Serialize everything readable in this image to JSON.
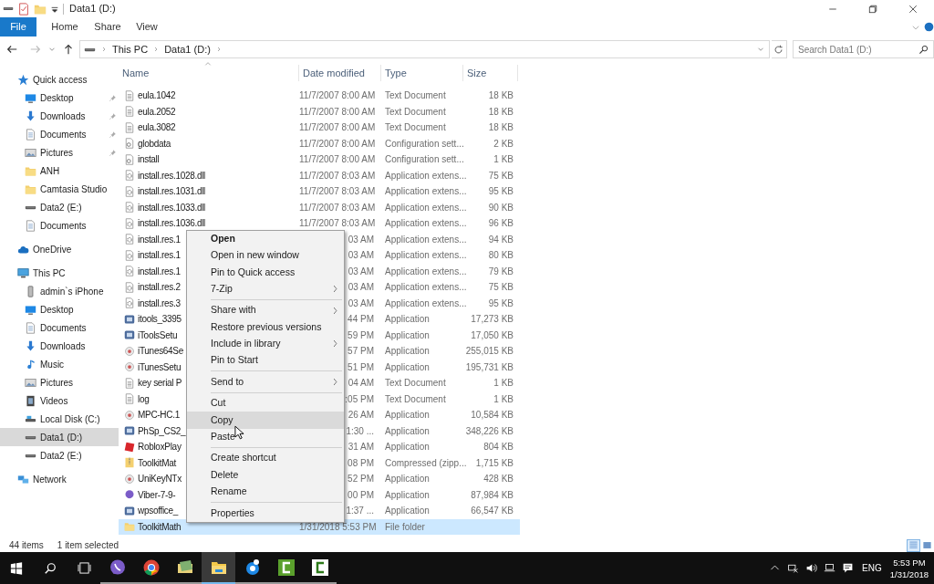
{
  "window": {
    "title": "Data1 (D:)"
  },
  "ribbon_tabs": [
    {
      "label": "File",
      "kind": "file"
    },
    {
      "label": "Home",
      "kind": "tab"
    },
    {
      "label": "Share",
      "kind": "tab"
    },
    {
      "label": "View",
      "kind": "tab"
    }
  ],
  "address": {
    "path": [
      "This PC",
      "Data1 (D:)"
    ],
    "search_placeholder": "Search Data1 (D:)"
  },
  "nav": [
    {
      "label": "Quick access",
      "kind": "star",
      "selected": false,
      "children": [
        {
          "label": "Desktop",
          "kind": "desktop",
          "pinned": true,
          "selected": false
        },
        {
          "label": "Downloads",
          "kind": "download",
          "pinned": true,
          "selected": false
        },
        {
          "label": "Documents",
          "kind": "document",
          "pinned": true,
          "selected": false
        },
        {
          "label": "Pictures",
          "kind": "picture",
          "pinned": true,
          "selected": false
        },
        {
          "label": "ANH",
          "kind": "folder",
          "pinned": false,
          "selected": false
        },
        {
          "label": "Camtasia Studio",
          "kind": "folder",
          "pinned": false,
          "selected": false
        },
        {
          "label": "Data2 (E:)",
          "kind": "drive",
          "pinned": false,
          "selected": false
        },
        {
          "label": "Documents",
          "kind": "document",
          "pinned": false,
          "selected": false
        }
      ]
    },
    {
      "label": "OneDrive",
      "kind": "cloud",
      "selected": false
    },
    {
      "label": "This PC",
      "kind": "pc",
      "selected": false,
      "children": [
        {
          "label": "admin`s iPhone",
          "kind": "phone",
          "selected": false
        },
        {
          "label": "Desktop",
          "kind": "desktop",
          "selected": false
        },
        {
          "label": "Documents",
          "kind": "document",
          "selected": false
        },
        {
          "label": "Downloads",
          "kind": "download",
          "selected": false
        },
        {
          "label": "Music",
          "kind": "music",
          "selected": false
        },
        {
          "label": "Pictures",
          "kind": "picture",
          "selected": false
        },
        {
          "label": "Videos",
          "kind": "video",
          "selected": false
        },
        {
          "label": "Local Disk (C:)",
          "kind": "localdisk",
          "selected": false
        },
        {
          "label": "Data1 (D:)",
          "kind": "drive",
          "selected": true
        },
        {
          "label": "Data2 (E:)",
          "kind": "drive",
          "selected": false
        }
      ]
    },
    {
      "label": "Network",
      "kind": "network",
      "selected": false
    }
  ],
  "file_list": {
    "columns": [
      "Name",
      "Date modified",
      "Type",
      "Size"
    ],
    "rows": [
      {
        "name": "eula.1042",
        "date": "11/7/2007 8:00 AM",
        "type": "Text Document",
        "size": "18 KB",
        "kind": "text",
        "selected": false
      },
      {
        "name": "eula.2052",
        "date": "11/7/2007 8:00 AM",
        "type": "Text Document",
        "size": "18 KB",
        "kind": "text",
        "selected": false
      },
      {
        "name": "eula.3082",
        "date": "11/7/2007 8:00 AM",
        "type": "Text Document",
        "size": "18 KB",
        "kind": "text",
        "selected": false
      },
      {
        "name": "globdata",
        "date": "11/7/2007 8:00 AM",
        "type": "Configuration sett...",
        "size": "2 KB",
        "kind": "config",
        "selected": false
      },
      {
        "name": "install",
        "date": "11/7/2007 8:00 AM",
        "type": "Configuration sett...",
        "size": "1 KB",
        "kind": "config",
        "selected": false
      },
      {
        "name": "install.res.1028.dll",
        "date": "11/7/2007 8:03 AM",
        "type": "Application extens...",
        "size": "75 KB",
        "kind": "dll",
        "selected": false
      },
      {
        "name": "install.res.1031.dll",
        "date": "11/7/2007 8:03 AM",
        "type": "Application extens...",
        "size": "95 KB",
        "kind": "dll",
        "selected": false
      },
      {
        "name": "install.res.1033.dll",
        "date": "11/7/2007 8:03 AM",
        "type": "Application extens...",
        "size": "90 KB",
        "kind": "dll",
        "selected": false
      },
      {
        "name": "install.res.1036.dll",
        "date": "11/7/2007 8:03 AM",
        "type": "Application extens...",
        "size": "96 KB",
        "kind": "dll",
        "selected": false
      },
      {
        "name": "install.res.1",
        "date": "03 AM",
        "type": "Application extens...",
        "size": "94 KB",
        "kind": "dll",
        "selected": false
      },
      {
        "name": "install.res.1",
        "date": "03 AM",
        "type": "Application extens...",
        "size": "80 KB",
        "kind": "dll",
        "selected": false
      },
      {
        "name": "install.res.1",
        "date": "03 AM",
        "type": "Application extens...",
        "size": "79 KB",
        "kind": "dll",
        "selected": false
      },
      {
        "name": "install.res.2",
        "date": "03 AM",
        "type": "Application extens...",
        "size": "75 KB",
        "kind": "dll",
        "selected": false
      },
      {
        "name": "install.res.3",
        "date": "03 AM",
        "type": "Application extens...",
        "size": "95 KB",
        "kind": "dll",
        "selected": false
      },
      {
        "name": "itools_3395",
        "date": "44 PM",
        "type": "Application",
        "size": "17,273 KB",
        "kind": "app",
        "selected": false
      },
      {
        "name": "iToolsSetu",
        "date": "59 PM",
        "type": "Application",
        "size": "17,050 KB",
        "kind": "app",
        "selected": false
      },
      {
        "name": "iTunes64Se",
        "date": "57 PM",
        "type": "Application",
        "size": "255,015 KB",
        "kind": "installer",
        "selected": false
      },
      {
        "name": "iTunesSetu",
        "date": "51 PM",
        "type": "Application",
        "size": "195,731 KB",
        "kind": "installer",
        "selected": false
      },
      {
        "name": "key serial P",
        "date": "04 AM",
        "type": "Text Document",
        "size": "1 KB",
        "kind": "text",
        "selected": false
      },
      {
        "name": "log",
        "date": ":05 PM",
        "type": "Text Document",
        "size": "1 KB",
        "kind": "text",
        "selected": false
      },
      {
        "name": "MPC-HC.1",
        "date": "26 AM",
        "type": "Application",
        "size": "10,584 KB",
        "kind": "installer",
        "selected": false
      },
      {
        "name": "PhSp_CS2_",
        "date": "1:30 ...",
        "type": "Application",
        "size": "348,226 KB",
        "kind": "app",
        "selected": false
      },
      {
        "name": "RobloxPlay",
        "date": "31 AM",
        "type": "Application",
        "size": "804 KB",
        "kind": "roblox",
        "selected": false
      },
      {
        "name": "ToolkitMat",
        "date": "08 PM",
        "type": "Compressed (zipp...",
        "size": "1,715 KB",
        "kind": "zip",
        "selected": false
      },
      {
        "name": "UniKeyNTx",
        "date": "52 PM",
        "type": "Application",
        "size": "428 KB",
        "kind": "installer",
        "selected": false
      },
      {
        "name": "Viber-7-9-",
        "date": "00 PM",
        "type": "Application",
        "size": "87,984 KB",
        "kind": "viber",
        "selected": false
      },
      {
        "name": "wpsoffice_",
        "date": "1:37 ...",
        "type": "Application",
        "size": "66,547 KB",
        "kind": "app",
        "selected": false
      },
      {
        "name": "ToolkitMath",
        "date": "1/31/2018 5:53 PM",
        "type": "File folder",
        "size": "",
        "kind": "folder",
        "selected": true
      }
    ]
  },
  "context_menu": [
    {
      "kind": "item",
      "label": "Open",
      "default": true,
      "submenu": false,
      "highlighted": false
    },
    {
      "kind": "item",
      "label": "Open in new window",
      "default": false,
      "submenu": false,
      "highlighted": false
    },
    {
      "kind": "item",
      "label": "Pin to Quick access",
      "default": false,
      "submenu": false,
      "highlighted": false
    },
    {
      "kind": "item",
      "label": "7-Zip",
      "default": false,
      "submenu": true,
      "highlighted": false
    },
    {
      "kind": "separator"
    },
    {
      "kind": "item",
      "label": "Share with",
      "default": false,
      "submenu": true,
      "highlighted": false
    },
    {
      "kind": "item",
      "label": "Restore previous versions",
      "default": false,
      "submenu": false,
      "highlighted": false
    },
    {
      "kind": "item",
      "label": "Include in library",
      "default": false,
      "submenu": true,
      "highlighted": false
    },
    {
      "kind": "item",
      "label": "Pin to Start",
      "default": false,
      "submenu": false,
      "highlighted": false
    },
    {
      "kind": "separator"
    },
    {
      "kind": "item",
      "label": "Send to",
      "default": false,
      "submenu": true,
      "highlighted": false
    },
    {
      "kind": "separator"
    },
    {
      "kind": "item",
      "label": "Cut",
      "default": false,
      "submenu": false,
      "highlighted": false
    },
    {
      "kind": "item",
      "label": "Copy",
      "default": false,
      "submenu": false,
      "highlighted": true
    },
    {
      "kind": "item",
      "label": "Paste",
      "default": false,
      "submenu": false,
      "highlighted": false
    },
    {
      "kind": "separator"
    },
    {
      "kind": "item",
      "label": "Create shortcut",
      "default": false,
      "submenu": false,
      "highlighted": false
    },
    {
      "kind": "item",
      "label": "Delete",
      "default": false,
      "submenu": false,
      "highlighted": false
    },
    {
      "kind": "item",
      "label": "Rename",
      "default": false,
      "submenu": false,
      "highlighted": false
    },
    {
      "kind": "separator"
    },
    {
      "kind": "item",
      "label": "Properties",
      "default": false,
      "submenu": false,
      "highlighted": false
    }
  ],
  "status_bar": {
    "count": "44 items",
    "selection": "1 item selected",
    "views": [
      {
        "kind": "details",
        "selected": true
      },
      {
        "kind": "thumbnails",
        "selected": false
      }
    ]
  },
  "taskbar": {
    "apps": [
      {
        "kind": "viber",
        "selected": false
      },
      {
        "kind": "chrome",
        "selected": false
      },
      {
        "kind": "photos",
        "selected": false
      },
      {
        "kind": "explorer",
        "selected": true
      },
      {
        "kind": "disc",
        "selected": false
      },
      {
        "kind": "camtasia",
        "selected": false
      },
      {
        "kind": "camtasia-light",
        "selected": false
      }
    ],
    "language": "ENG",
    "time": "5:53 PM",
    "date": "1/31/2018"
  }
}
